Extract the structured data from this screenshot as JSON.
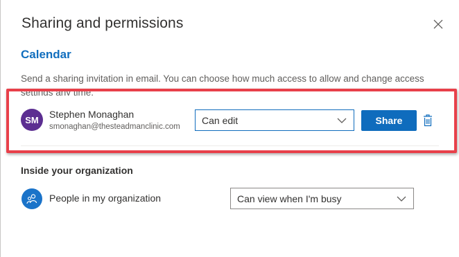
{
  "dialog": {
    "title": "Sharing and permissions",
    "close_icon": "close-icon"
  },
  "calendar": {
    "section_title": "Calendar",
    "description": "Send a sharing invitation in email. You can choose how much access to allow and change access settings any time."
  },
  "invitee": {
    "initials": "SM",
    "name": "Stephen Monaghan",
    "email": "smonaghan@thesteadmanclinic.com",
    "permission": "Can edit",
    "share_label": "Share",
    "delete_icon": "trash-icon",
    "avatar_color": "#5c2e91"
  },
  "organization": {
    "section_title": "Inside your organization",
    "label": "People in my organization",
    "permission": "Can view when I'm busy",
    "icon": "people-icon"
  },
  "colors": {
    "accent": "#0f6cbd",
    "highlight": "#e8404a"
  }
}
